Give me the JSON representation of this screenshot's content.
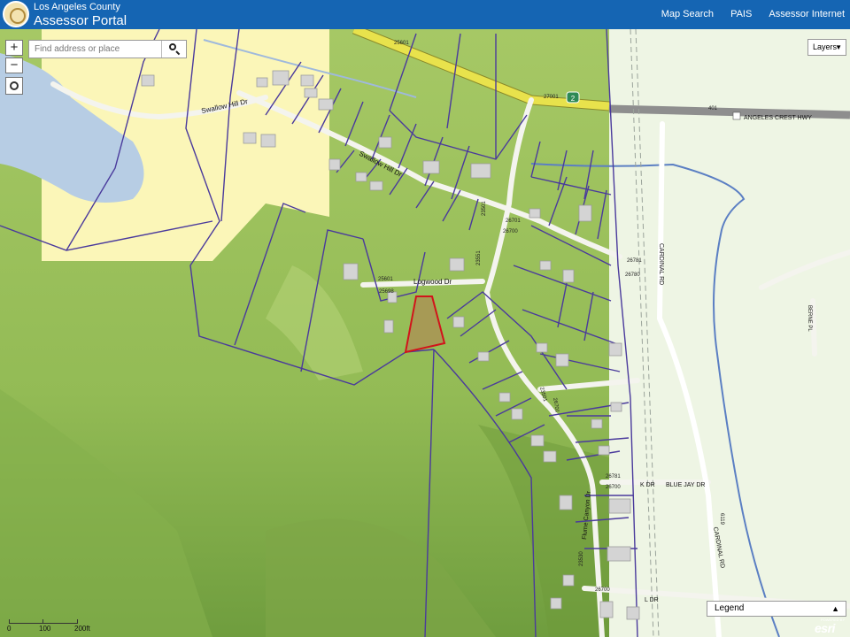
{
  "header": {
    "brand_sub": "Los Angeles County",
    "brand_main": "Assessor Portal",
    "nav": [
      "Map Search",
      "PAIS",
      "Assessor Internet"
    ]
  },
  "search": {
    "placeholder": "Find address or place"
  },
  "layers": {
    "label": "Layers"
  },
  "legend": {
    "label": "Legend",
    "state": "collapsed"
  },
  "zoom": {
    "in": "+",
    "out": "−"
  },
  "scale": {
    "labels": [
      "0",
      "100",
      "200ft"
    ]
  },
  "attribution": {
    "credit": "POWERED BY",
    "logo": "esri"
  },
  "map": {
    "streets": {
      "swallow_hill_1": "Swallow Hill Dr",
      "swallow_hill_2": "Swallow Hill Dr",
      "logwood": "Logwood Dr",
      "angeles_crest": "ANGELES CREST HWY",
      "cardinal_rd_n": "CARDINAL RD",
      "cardinal_rd_s": "CARDINAL RD",
      "flume_canyon": "Flume Canyon Dr",
      "blue_jay": "BLUE JAY DR",
      "berne": "BERNE PL",
      "k_dr": "K DR",
      "l_dr": "L DR"
    },
    "route_shield": "2",
    "parcels": {
      "p1": "25601",
      "p2": "27001",
      "p3": "26701",
      "p4": "26700",
      "p5": "26781",
      "p6": "26780",
      "p7": "25601",
      "p8": "25698",
      "p9": "23501",
      "p10": "23551",
      "p11": "23501",
      "p12": "26701",
      "p13": "26781",
      "p14": "26700",
      "p15": "26700",
      "p16": "23530",
      "p17": "401",
      "p18": "6119"
    },
    "colors": {
      "terrain": "#a9c96a",
      "zoned_yellow": "#fbf6b8",
      "parcel_line": "#4a3a9c",
      "selected_parcel": "#d1141b",
      "water": "#b7cde4",
      "highway": "#e8e24c"
    }
  }
}
